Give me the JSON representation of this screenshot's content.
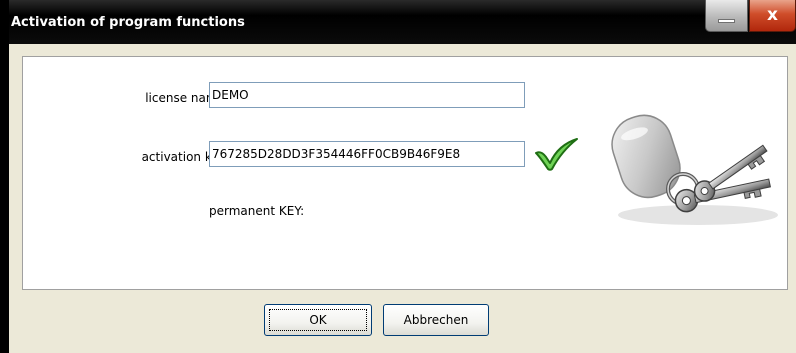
{
  "window": {
    "title": "Activation of program functions",
    "close_glyph": "x"
  },
  "form": {
    "license_name_label": "license name:",
    "license_name_value": "DEMO",
    "activation_key_label": "activation key:",
    "activation_key_value": "767285D28DD3F354446FF0CB9B46F9E8",
    "permanent_key_label": "permanent KEY:"
  },
  "buttons": {
    "ok_label": "OK",
    "cancel_label": "Abbrechen"
  },
  "icons": {
    "validation": "checkmark-icon",
    "illustration": "keys-icon",
    "minimize": "minimize-icon",
    "close": "close-icon"
  },
  "colors": {
    "checkmark": "#3aa52a",
    "title_bar": "#000000",
    "close_button": "#c94a27",
    "input_border": "#7f9db9"
  }
}
